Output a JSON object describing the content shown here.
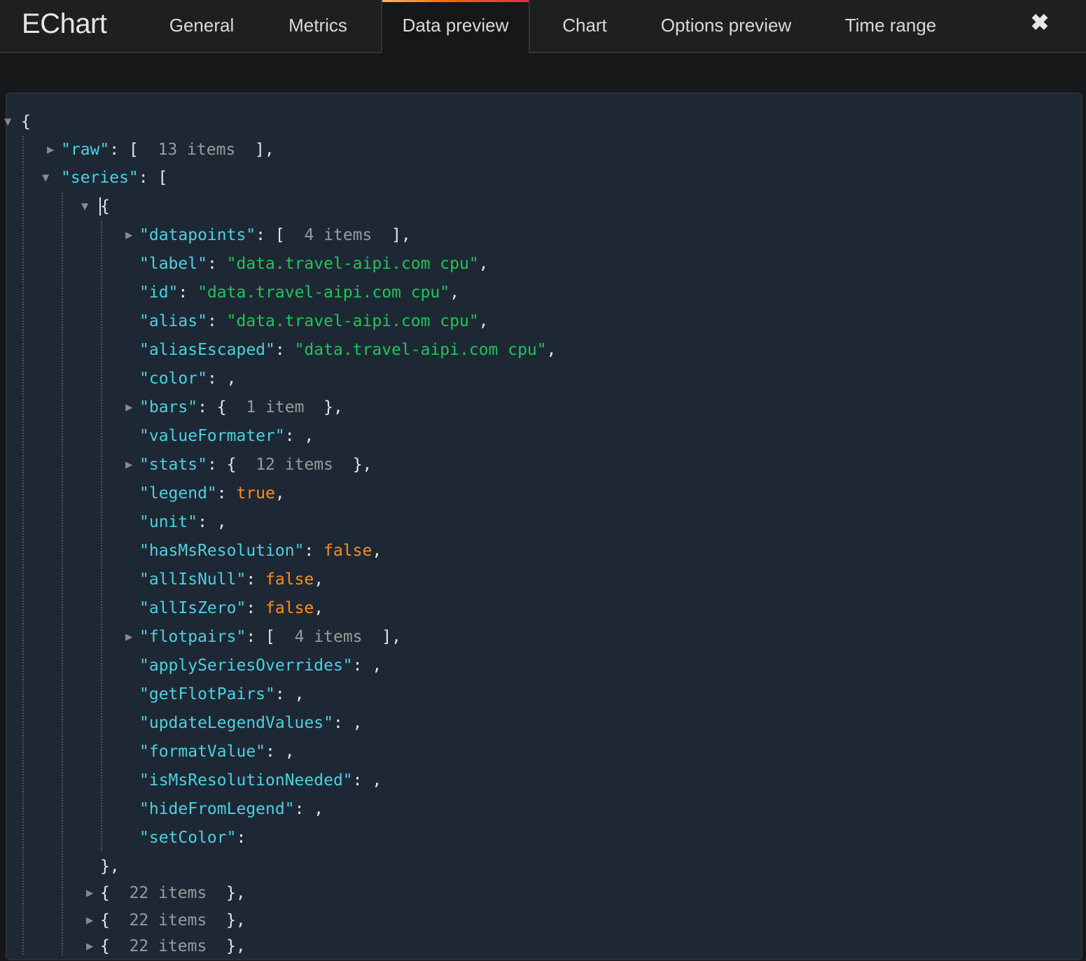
{
  "header": {
    "title": "EChart",
    "tabs": [
      {
        "label": "General",
        "active": false
      },
      {
        "label": "Metrics",
        "active": false
      },
      {
        "label": "Data preview",
        "active": true
      },
      {
        "label": "Chart",
        "active": false
      },
      {
        "label": "Options preview",
        "active": false
      },
      {
        "label": "Time range",
        "active": false
      }
    ],
    "close_icon": "✖"
  },
  "tree": {
    "root_open": "{",
    "raw": {
      "key": "\"raw\"",
      "open": "[",
      "summary": "13 items",
      "close": "],"
    },
    "series": {
      "key": "\"series\"",
      "open": "["
    },
    "series_item_open": "{",
    "fields": {
      "datapoints": {
        "key": "\"datapoints\"",
        "open": "[",
        "summary": "4 items",
        "close": "],"
      },
      "label": {
        "key": "\"label\"",
        "value": "\"data.travel-aipi.com cpu\""
      },
      "id": {
        "key": "\"id\"",
        "value": "\"data.travel-aipi.com cpu\""
      },
      "alias": {
        "key": "\"alias\"",
        "value": "\"data.travel-aipi.com cpu\""
      },
      "aliasEscaped": {
        "key": "\"aliasEscaped\"",
        "value": "\"data.travel-aipi.com cpu\""
      },
      "color": {
        "key": "\"color\""
      },
      "bars": {
        "key": "\"bars\"",
        "open": "{",
        "summary": "1 item",
        "close": "},"
      },
      "valueFormater": {
        "key": "\"valueFormater\""
      },
      "stats": {
        "key": "\"stats\"",
        "open": "{",
        "summary": "12 items",
        "close": "},"
      },
      "legend": {
        "key": "\"legend\"",
        "value": "true"
      },
      "unit": {
        "key": "\"unit\""
      },
      "hasMsResolution": {
        "key": "\"hasMsResolution\"",
        "value": "false"
      },
      "allIsNull": {
        "key": "\"allIsNull\"",
        "value": "false"
      },
      "allIsZero": {
        "key": "\"allIsZero\"",
        "value": "false"
      },
      "flotpairs": {
        "key": "\"flotpairs\"",
        "open": "[",
        "summary": "4 items",
        "close": "],"
      },
      "applySeriesOverrides": {
        "key": "\"applySeriesOverrides\""
      },
      "getFlotPairs": {
        "key": "\"getFlotPairs\""
      },
      "updateLegendValues": {
        "key": "\"updateLegendValues\""
      },
      "formatValue": {
        "key": "\"formatValue\""
      },
      "isMsResolutionNeeded": {
        "key": "\"isMsResolutionNeeded\""
      },
      "hideFromLegend": {
        "key": "\"hideFromLegend\""
      },
      "setColor": {
        "key": "\"setColor\""
      }
    },
    "series_item_close": "},",
    "collapsed_items": [
      {
        "open": "{",
        "summary": "22 items",
        "close": "},"
      },
      {
        "open": "{",
        "summary": "22 items",
        "close": "},"
      },
      {
        "open": "{",
        "summary": "22 items",
        "close": "},"
      }
    ]
  }
}
